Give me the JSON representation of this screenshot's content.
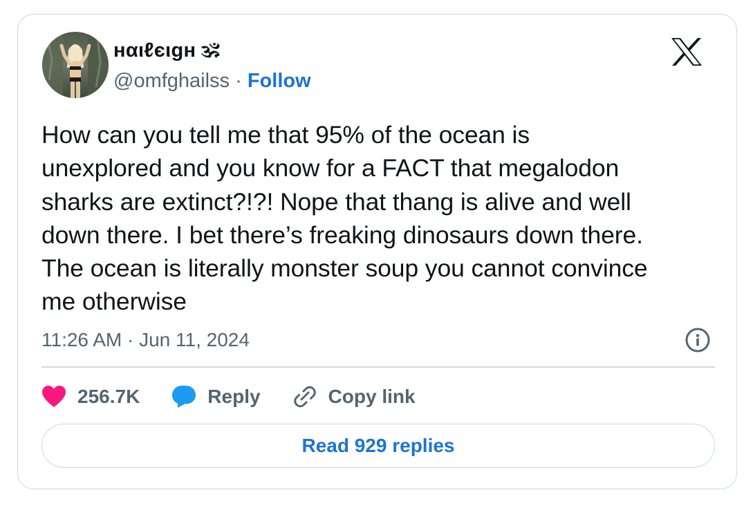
{
  "tweet": {
    "author": {
      "display_name": "нαιℓєιgн 🕉",
      "handle": "@omfghailss",
      "separator": " · ",
      "follow_label": "Follow"
    },
    "text": "How can you tell me that 95% of the ocean is\nunexplored and you know for a FACT that megalodon\nsharks are extinct?!?! Nope that thang is alive and well\ndown there. I bet there’s freaking dinosaurs down there.\nThe ocean is literally monster soup you cannot convince\nme otherwise",
    "timestamp": "11:26 AM · Jun 11, 2024",
    "actions": {
      "like_count": "256.7K",
      "reply_label": "Reply",
      "copy_link_label": "Copy link"
    },
    "read_replies_label": "Read 929 replies"
  },
  "icons": {
    "brand": "x-logo-icon",
    "info": "info-icon",
    "like": "heart-icon",
    "reply": "speech-bubble-icon",
    "copy": "link-icon"
  },
  "colors": {
    "link_blue": "#1d74d1",
    "heart_pink": "#f91880",
    "reply_blue": "#1d9bf0",
    "secondary_text": "#536471",
    "border": "#cfd9de"
  }
}
